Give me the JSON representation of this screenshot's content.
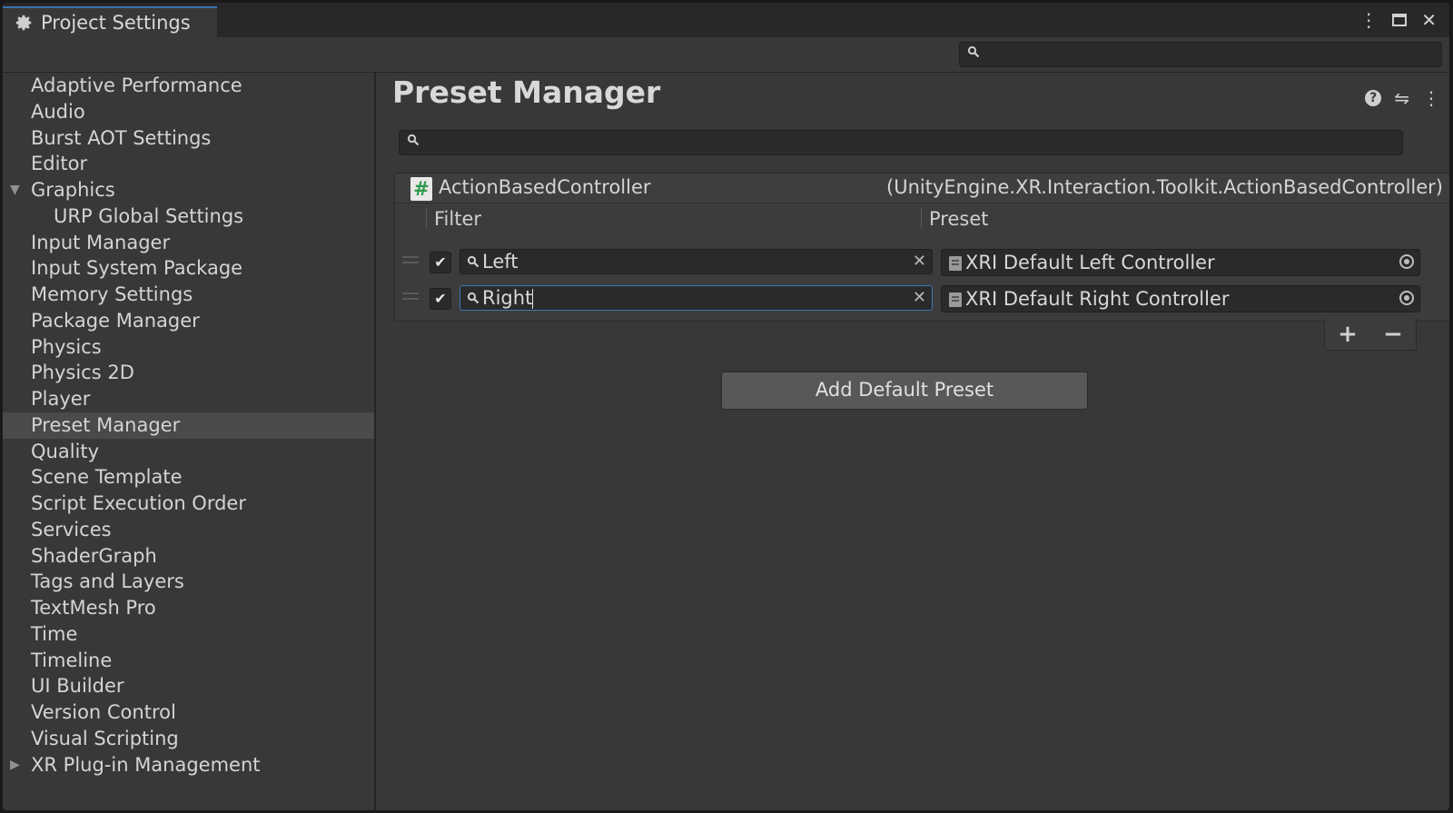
{
  "window": {
    "tab_title": "Project Settings",
    "controls": [
      "⋮",
      "max",
      "✕"
    ]
  },
  "sidebar": {
    "items": [
      {
        "label": "Adaptive Performance"
      },
      {
        "label": "Audio"
      },
      {
        "label": "Burst AOT Settings"
      },
      {
        "label": "Editor"
      },
      {
        "label": "Graphics",
        "fold": "expanded"
      },
      {
        "label": "URP Global Settings",
        "child": true
      },
      {
        "label": "Input Manager"
      },
      {
        "label": "Input System Package"
      },
      {
        "label": "Memory Settings"
      },
      {
        "label": "Package Manager"
      },
      {
        "label": "Physics"
      },
      {
        "label": "Physics 2D"
      },
      {
        "label": "Player"
      },
      {
        "label": "Preset Manager",
        "selected": true
      },
      {
        "label": "Quality"
      },
      {
        "label": "Scene Template"
      },
      {
        "label": "Script Execution Order"
      },
      {
        "label": "Services"
      },
      {
        "label": "ShaderGraph"
      },
      {
        "label": "Tags and Layers"
      },
      {
        "label": "TextMesh Pro"
      },
      {
        "label": "Time"
      },
      {
        "label": "Timeline"
      },
      {
        "label": "UI Builder"
      },
      {
        "label": "Version Control"
      },
      {
        "label": "Visual Scripting"
      },
      {
        "label": "XR Plug-in Management",
        "fold": "collapsed"
      }
    ]
  },
  "main": {
    "title": "Preset Manager",
    "search_value": "",
    "type_name": "ActionBasedController",
    "type_full": "(UnityEngine.XR.Interaction.Toolkit.ActionBasedController)",
    "columns": {
      "filter": "Filter",
      "preset": "Preset"
    },
    "rows": [
      {
        "enabled": true,
        "filter": "Left",
        "preset": "XRI Default Left Controller",
        "focused": false
      },
      {
        "enabled": true,
        "filter": "Right",
        "preset": "XRI Default Right Controller",
        "focused": true
      }
    ],
    "add_label": "+",
    "remove_label": "−",
    "default_button": "Add Default Preset"
  },
  "icons": {
    "tab": "gear-icon",
    "search": "search-icon",
    "help": "help-icon",
    "settings": "sliders-icon",
    "more": "more-vertical-icon",
    "type": "script-icon",
    "asset": "preset-asset-icon",
    "picker": "object-picker-icon"
  },
  "colors": {
    "window_bg": "#383838",
    "selected_item": "#4a4a4a",
    "focus_border": "#3a79bb",
    "script_icon_green": "#2f9a4a"
  }
}
